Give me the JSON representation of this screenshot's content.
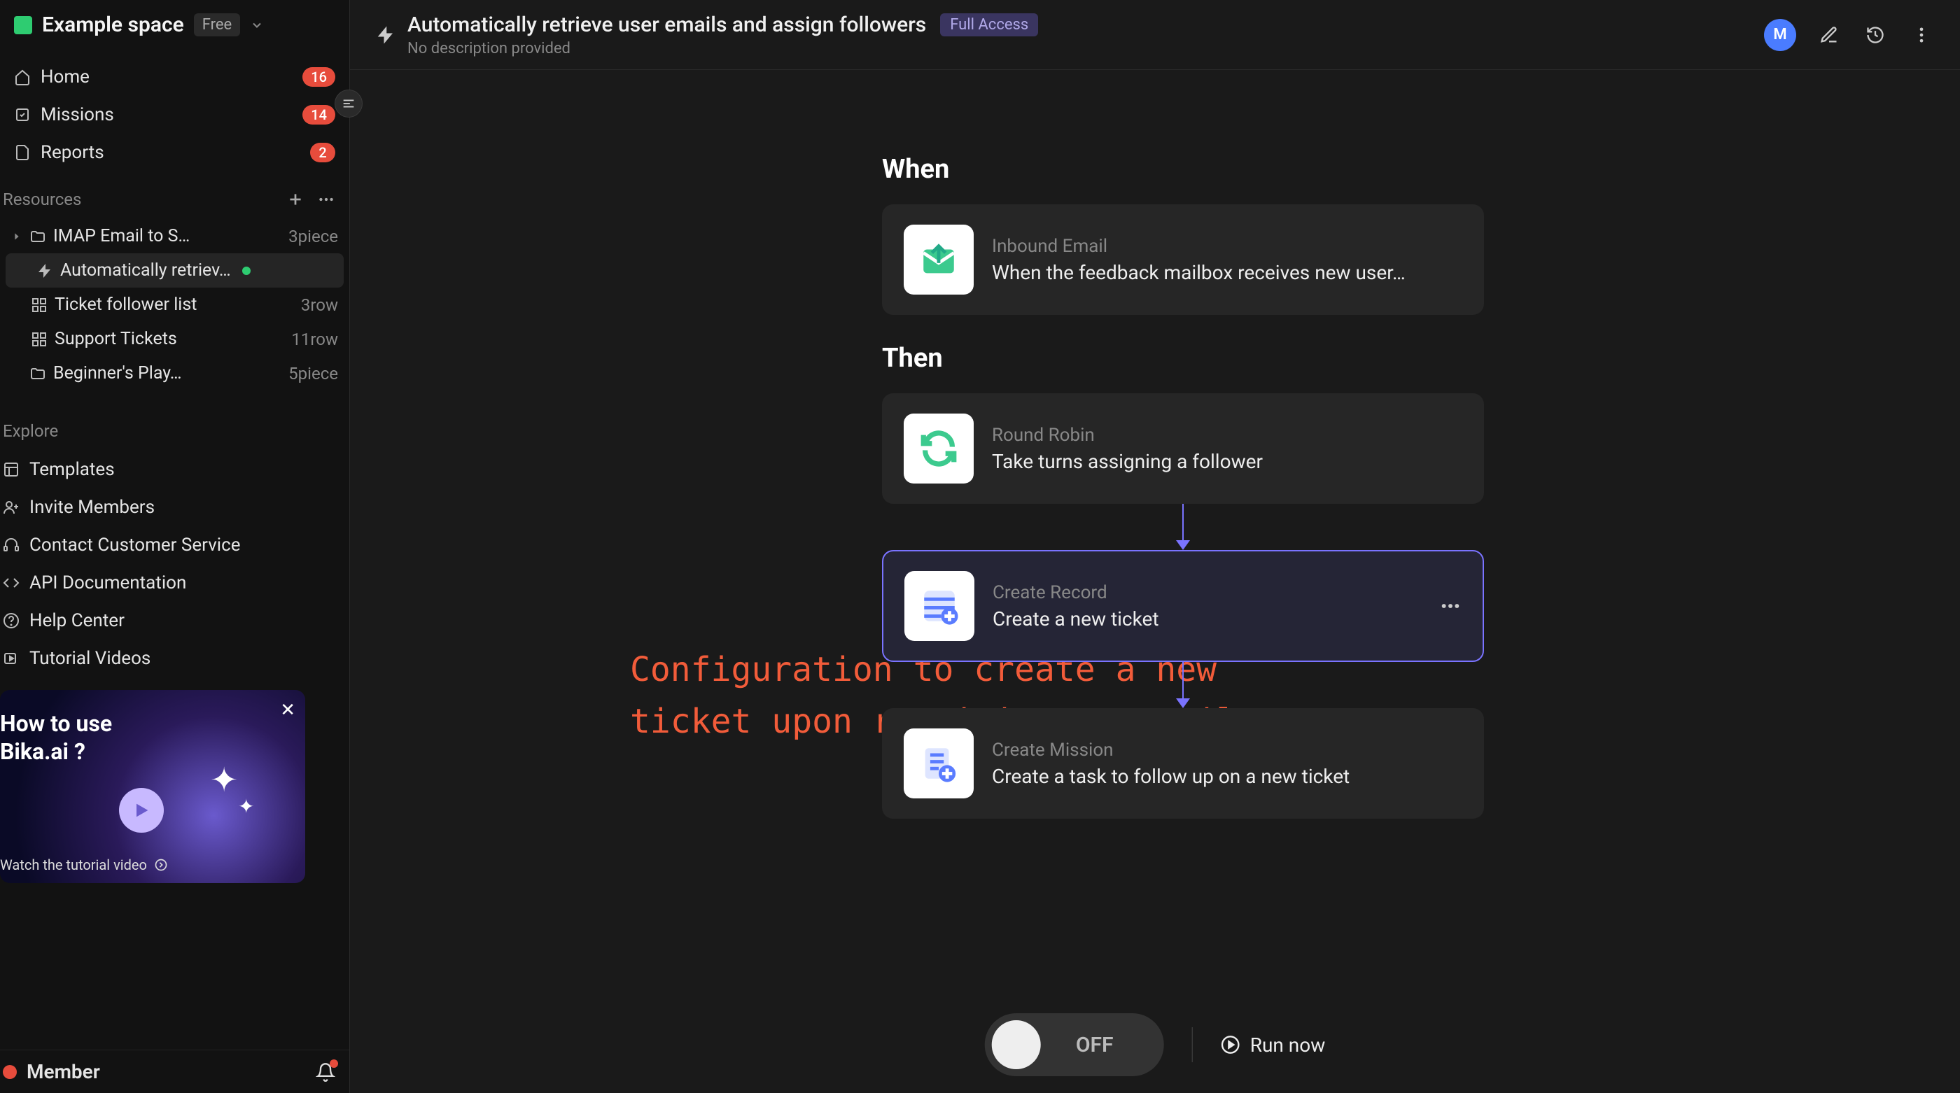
{
  "workspace": {
    "name": "Example space",
    "plan": "Free"
  },
  "nav": [
    {
      "label": "Home",
      "count": "16"
    },
    {
      "label": "Missions",
      "count": "14"
    },
    {
      "label": "Reports",
      "count": "2"
    }
  ],
  "resources": {
    "header": "Resources",
    "items": [
      {
        "label": "IMAP Email to S…",
        "meta": "3piece",
        "icon": "folder"
      },
      {
        "label": "Automatically retriev…",
        "meta": "",
        "icon": "bolt",
        "active": true,
        "status_dot": true
      },
      {
        "label": "Ticket follower list",
        "meta": "3row",
        "icon": "grid"
      },
      {
        "label": "Support Tickets",
        "meta": "11row",
        "icon": "grid"
      },
      {
        "label": "Beginner's Play…",
        "meta": "5piece",
        "icon": "folder"
      }
    ]
  },
  "explore": {
    "header": "Explore",
    "items": [
      {
        "label": "Templates"
      },
      {
        "label": "Invite Members"
      },
      {
        "label": "Contact Customer Service"
      },
      {
        "label": "API Documentation"
      },
      {
        "label": "Help Center"
      },
      {
        "label": "Tutorial Videos"
      }
    ]
  },
  "promo": {
    "title_line1": "How to use",
    "title_line2": "Bika.ai ?",
    "caption": "Watch the tutorial video"
  },
  "footer": {
    "label": "Member"
  },
  "topbar": {
    "title": "Automatically retrieve user emails and assign followers",
    "subtitle": "No description provided",
    "access": "Full Access",
    "avatar": "M"
  },
  "flow": {
    "when_label": "When",
    "then_label": "Then",
    "trigger": {
      "type": "Inbound Email",
      "title": "When the feedback mailbox receives new user…"
    },
    "actions": [
      {
        "type": "Round Robin",
        "title": "Take turns assigning a follower"
      },
      {
        "type": "Create Record",
        "title": "Create a new ticket",
        "selected": true,
        "more": true
      },
      {
        "type": "Create Mission",
        "title": "Create a task to follow up on a new ticket"
      }
    ]
  },
  "controls": {
    "toggle": "OFF",
    "run": "Run now"
  },
  "annotation": "Configuration to create a new ticket upon receiving an email"
}
